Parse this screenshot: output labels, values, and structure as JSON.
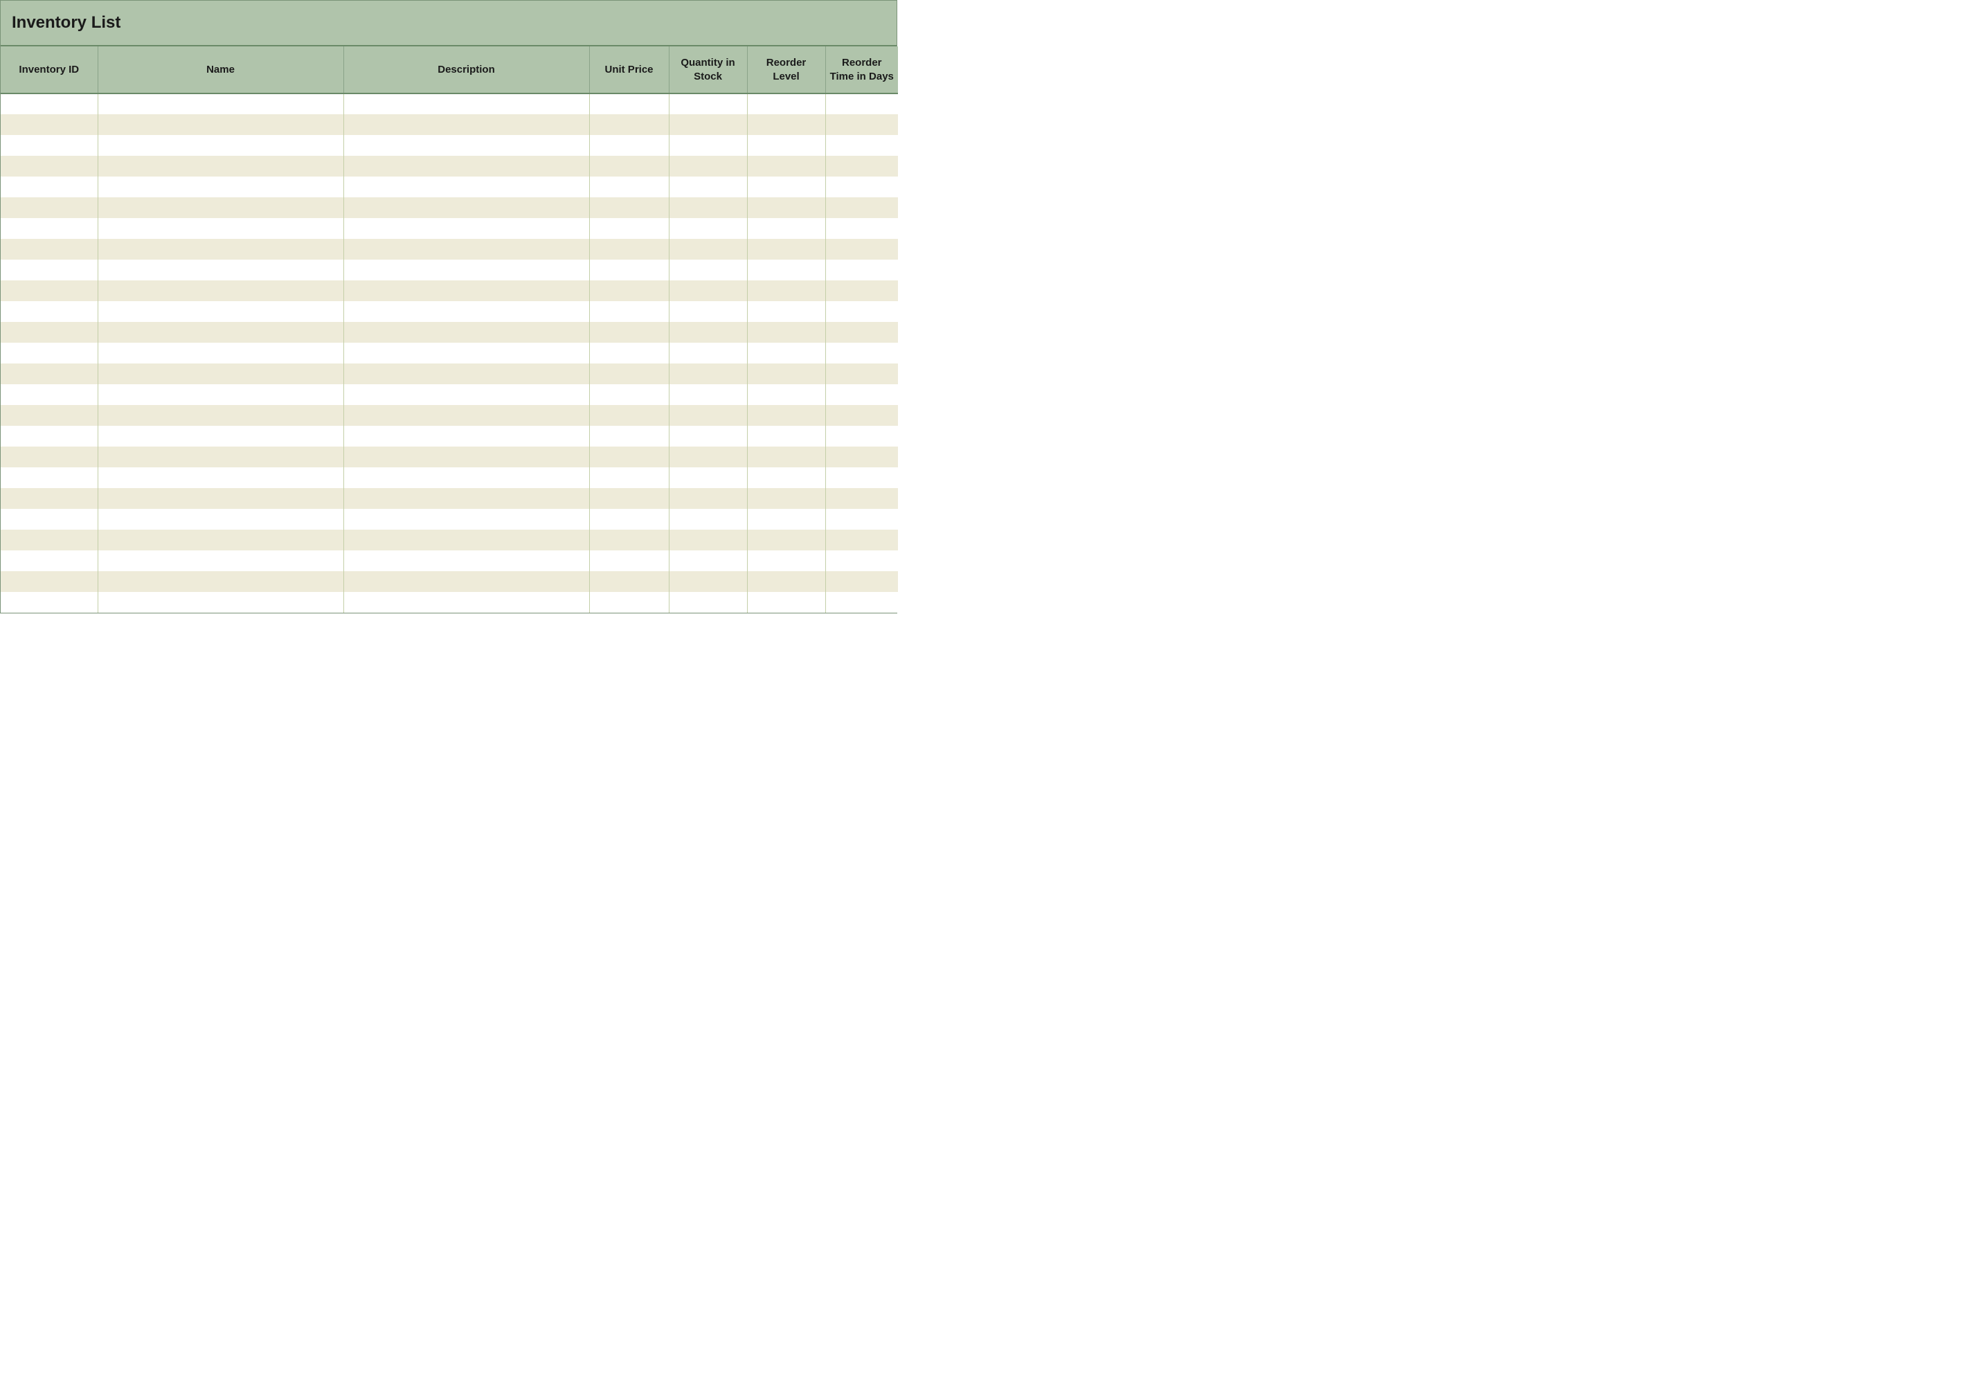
{
  "title": "Inventory List",
  "columns": [
    {
      "key": "id",
      "label": "Inventory ID"
    },
    {
      "key": "name",
      "label": "Name"
    },
    {
      "key": "desc",
      "label": "Description"
    },
    {
      "key": "price",
      "label": "Unit Price"
    },
    {
      "key": "qty",
      "label": "Quantity in Stock"
    },
    {
      "key": "reorder",
      "label": "Reorder Level"
    },
    {
      "key": "days",
      "label": "Reorder Time in Days"
    }
  ],
  "rows": [
    {
      "id": "",
      "name": "",
      "desc": "",
      "price": "",
      "qty": "",
      "reorder": "",
      "days": ""
    },
    {
      "id": "",
      "name": "",
      "desc": "",
      "price": "",
      "qty": "",
      "reorder": "",
      "days": ""
    },
    {
      "id": "",
      "name": "",
      "desc": "",
      "price": "",
      "qty": "",
      "reorder": "",
      "days": ""
    },
    {
      "id": "",
      "name": "",
      "desc": "",
      "price": "",
      "qty": "",
      "reorder": "",
      "days": ""
    },
    {
      "id": "",
      "name": "",
      "desc": "",
      "price": "",
      "qty": "",
      "reorder": "",
      "days": ""
    },
    {
      "id": "",
      "name": "",
      "desc": "",
      "price": "",
      "qty": "",
      "reorder": "",
      "days": ""
    },
    {
      "id": "",
      "name": "",
      "desc": "",
      "price": "",
      "qty": "",
      "reorder": "",
      "days": ""
    },
    {
      "id": "",
      "name": "",
      "desc": "",
      "price": "",
      "qty": "",
      "reorder": "",
      "days": ""
    },
    {
      "id": "",
      "name": "",
      "desc": "",
      "price": "",
      "qty": "",
      "reorder": "",
      "days": ""
    },
    {
      "id": "",
      "name": "",
      "desc": "",
      "price": "",
      "qty": "",
      "reorder": "",
      "days": ""
    },
    {
      "id": "",
      "name": "",
      "desc": "",
      "price": "",
      "qty": "",
      "reorder": "",
      "days": ""
    },
    {
      "id": "",
      "name": "",
      "desc": "",
      "price": "",
      "qty": "",
      "reorder": "",
      "days": ""
    },
    {
      "id": "",
      "name": "",
      "desc": "",
      "price": "",
      "qty": "",
      "reorder": "",
      "days": ""
    },
    {
      "id": "",
      "name": "",
      "desc": "",
      "price": "",
      "qty": "",
      "reorder": "",
      "days": ""
    },
    {
      "id": "",
      "name": "",
      "desc": "",
      "price": "",
      "qty": "",
      "reorder": "",
      "days": ""
    },
    {
      "id": "",
      "name": "",
      "desc": "",
      "price": "",
      "qty": "",
      "reorder": "",
      "days": ""
    },
    {
      "id": "",
      "name": "",
      "desc": "",
      "price": "",
      "qty": "",
      "reorder": "",
      "days": ""
    },
    {
      "id": "",
      "name": "",
      "desc": "",
      "price": "",
      "qty": "",
      "reorder": "",
      "days": ""
    },
    {
      "id": "",
      "name": "",
      "desc": "",
      "price": "",
      "qty": "",
      "reorder": "",
      "days": ""
    },
    {
      "id": "",
      "name": "",
      "desc": "",
      "price": "",
      "qty": "",
      "reorder": "",
      "days": ""
    },
    {
      "id": "",
      "name": "",
      "desc": "",
      "price": "",
      "qty": "",
      "reorder": "",
      "days": ""
    },
    {
      "id": "",
      "name": "",
      "desc": "",
      "price": "",
      "qty": "",
      "reorder": "",
      "days": ""
    },
    {
      "id": "",
      "name": "",
      "desc": "",
      "price": "",
      "qty": "",
      "reorder": "",
      "days": ""
    },
    {
      "id": "",
      "name": "",
      "desc": "",
      "price": "",
      "qty": "",
      "reorder": "",
      "days": ""
    },
    {
      "id": "",
      "name": "",
      "desc": "",
      "price": "",
      "qty": "",
      "reorder": "",
      "days": ""
    }
  ]
}
